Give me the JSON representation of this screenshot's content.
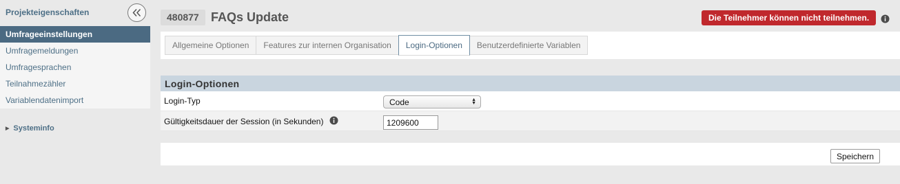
{
  "sidebar": {
    "title": "Projekteigenschaften",
    "active_item": "Umfrageeinstellungen",
    "items": [
      {
        "label": "Umfragemeldungen"
      },
      {
        "label": "Umfragesprachen"
      },
      {
        "label": "Teilnahmezähler"
      },
      {
        "label": "Variablendatenimport"
      }
    ],
    "systeminfo": "Systeminfo",
    "collapse_icon": "double-chevron-left-icon"
  },
  "header": {
    "survey_id": "480877",
    "title": "FAQs Update",
    "alert": "Die Teilnehmer können nicht teilnehmen.",
    "alert_color": "#c0282d"
  },
  "tabs": [
    {
      "label": "Allgemeine Optionen"
    },
    {
      "label": "Features zur internen Organisation"
    },
    {
      "label": "Login-Optionen"
    },
    {
      "label": "Benutzerdefinierte Variablen"
    }
  ],
  "active_tab": "Login-Optionen",
  "section": {
    "title": "Login-Optionen",
    "login_type_label": "Login-Typ",
    "login_type_value": "Code",
    "session_label": "Gültigkeitsdauer der Session (in Sekunden)",
    "session_value": "1209600"
  },
  "save_label": "Speichern",
  "colors": {
    "accent": "#4b6a82",
    "section_header": "#c9d5df",
    "background": "#e9e9e9"
  }
}
